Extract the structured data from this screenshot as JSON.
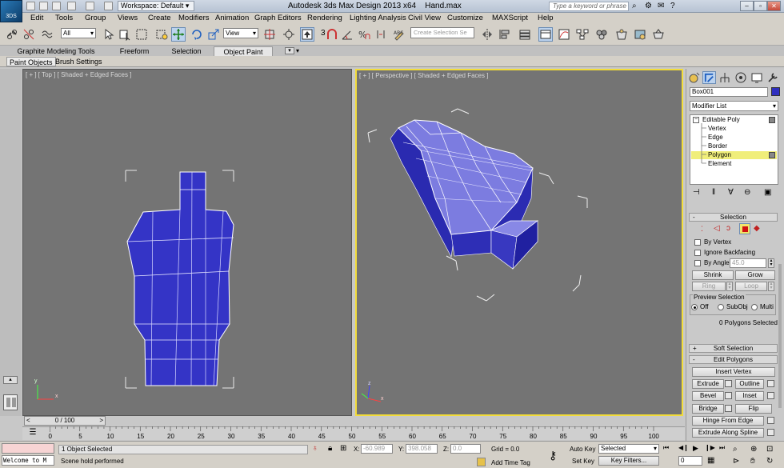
{
  "window": {
    "app_badge": "3DS",
    "workspace": "Workspace: Default",
    "title": "Autodesk 3ds Max Design 2013 x64",
    "file": "Hand.max",
    "search_placeholder": "Type a keyword or phrase"
  },
  "menu": [
    "Edit",
    "Tools",
    "Group",
    "Views",
    "Create",
    "Modifiers",
    "Animation",
    "Graph Editors",
    "Rendering",
    "Lighting Analysis",
    "Civil View",
    "Customize",
    "MAXScript",
    "Help"
  ],
  "toolbar": {
    "selection_filter": "All",
    "reference_coord": "View",
    "snap_label": "3",
    "named_selection_placeholder": "Create Selection Se"
  },
  "ribbon": {
    "tabs": [
      "Graphite Modeling Tools",
      "Freeform",
      "Selection",
      "Object Paint"
    ],
    "active_tab": "Object Paint",
    "subtabs": [
      "Paint Objects",
      "Brush Settings"
    ]
  },
  "viewports": {
    "top_label": "[ + ] [ Top ] [ Shaded + Edged Faces ]",
    "persp_label": "[ + ] [ Perspective ] [ Shaded + Edged Faces ]",
    "axis_x": "x",
    "axis_y": "y",
    "axis_z": "z",
    "mesh_color": "#3636c8",
    "mesh_light": "#7f7fe2",
    "active_border": "#f2dc3a"
  },
  "command_panel": {
    "object_name": "Box001",
    "object_color": "#2f2fc0",
    "modifier_list": "Modifier List",
    "stack": [
      "Editable Poly",
      "Vertex",
      "Edge",
      "Border",
      "Polygon",
      "Element"
    ],
    "selected_level": "Polygon",
    "selection": {
      "title": "Selection",
      "by_vertex": "By Vertex",
      "ignore_backfacing": "Ignore Backfacing",
      "by_angle": "By Angle:",
      "angle_value": "45.0",
      "shrink": "Shrink",
      "grow": "Grow",
      "ring": "Ring",
      "loop": "Loop",
      "preview_title": "Preview Selection",
      "preview_off": "Off",
      "preview_subobj": "SubObj",
      "preview_multi": "Multi",
      "status": "0 Polygons Selected"
    },
    "soft_selection": "Soft Selection",
    "edit_polygons": "Edit Polygons",
    "insert_vertex": "Insert Vertex",
    "extrude": "Extrude",
    "outline": "Outline",
    "bevel": "Bevel",
    "inset": "Inset",
    "bridge": "Bridge",
    "flip": "Flip",
    "hinge": "Hinge From Edge",
    "extrude_spline": "Extrude Along Spline"
  },
  "timeline": {
    "frame": "0 / 100",
    "ticks": [
      "0",
      "5",
      "10",
      "15",
      "20",
      "25",
      "30",
      "35",
      "40",
      "45",
      "50",
      "55",
      "60",
      "65",
      "70",
      "75",
      "80",
      "85",
      "90",
      "95",
      "100"
    ]
  },
  "status": {
    "maxscript": "Welcome to M",
    "selected": "1 Object Selected",
    "prompt": "Scene hold performed",
    "x_label": "X:",
    "x_value": "-60.989",
    "y_label": "Y:",
    "y_value": "398.058",
    "z_label": "Z:",
    "z_value": "0.0",
    "grid": "Grid = 0.0",
    "add_time_tag": "Add Time Tag",
    "auto_key": "Auto Key",
    "set_key": "Set Key",
    "key_mode": "Selected",
    "key_filters": "Key Filters...",
    "current_frame": "0"
  }
}
